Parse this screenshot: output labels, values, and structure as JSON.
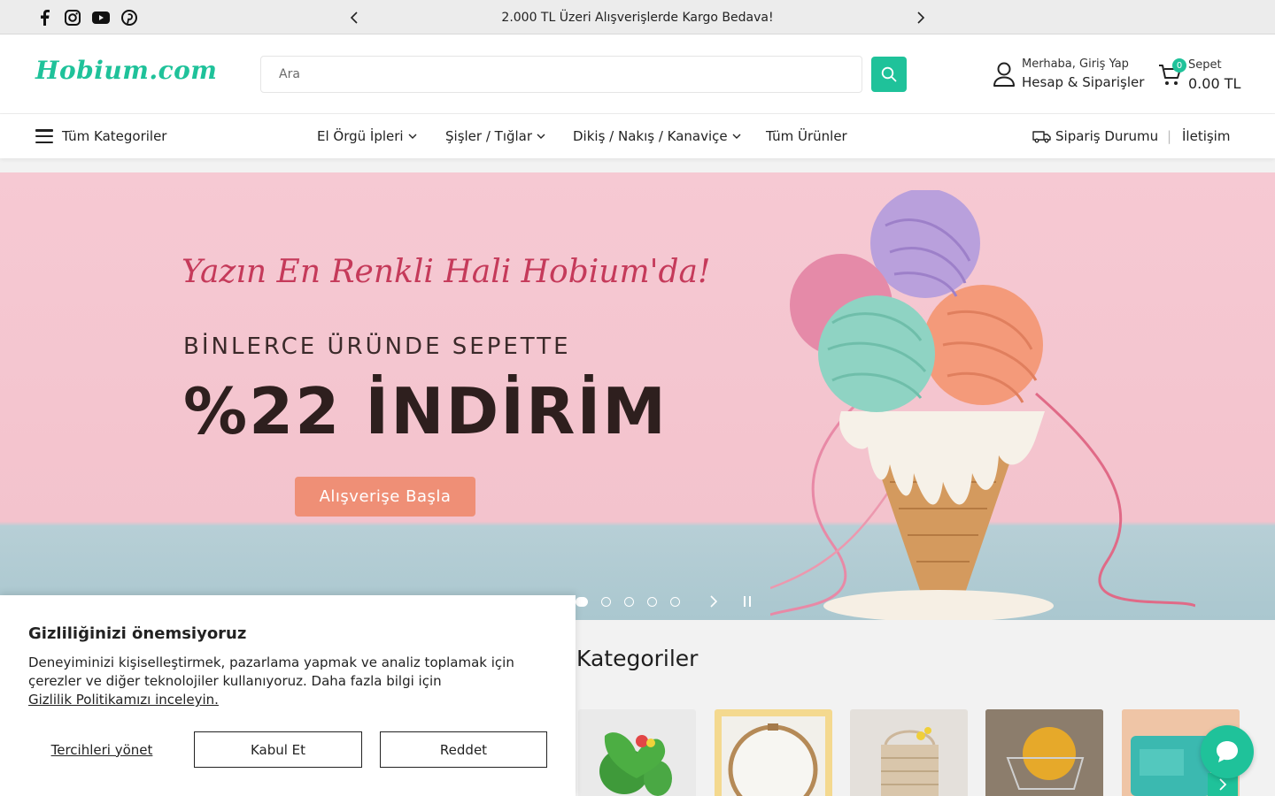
{
  "topbar": {
    "social": [
      "facebook-icon",
      "instagram-icon",
      "youtube-icon",
      "pinterest-icon"
    ],
    "promo_text": "2.000 TL Üzeri Alışverişlerde Kargo Bedava!"
  },
  "header": {
    "logo": "Hobium.com",
    "search_placeholder": "Ara",
    "account_greeting": "Merhaba, Giriş Yap",
    "account_label": "Hesap & Siparişler",
    "cart_label": "Sepet",
    "cart_total": "0.00 TL",
    "cart_count": "0"
  },
  "nav": {
    "all_categories": "Tüm Kategoriler",
    "items": [
      {
        "label": "El Örgü İpleri",
        "dropdown": true
      },
      {
        "label": "Şişler / Tığlar",
        "dropdown": true
      },
      {
        "label": "Dikiş / Nakış / Kanaviçe",
        "dropdown": true
      },
      {
        "label": "Tüm Ürünler",
        "dropdown": false
      }
    ],
    "order_status": "Sipariş Durumu",
    "separator": "|",
    "contact": "İletişim"
  },
  "hero": {
    "tagline": "Yazın En Renkli Hali Hobium'da!",
    "line1": "BİNLERCE ÜRÜNDE SEPETTE",
    "line2": "%22 İNDİRİM",
    "button": "Alışverişe Başla",
    "slide_count": 5,
    "active_slide": 1
  },
  "categories": {
    "title": "Kategoriler"
  },
  "cookie": {
    "title": "Gizliliğinizi önemsiyoruz",
    "text": "Deneyiminizi kişiselleştirmek, pazarlama yapmak ve analiz toplamak için çerezler ve diğer teknolojiler kullanıyoruz. Daha fazla bilgi için",
    "link": "Gizlilik Politikamızı inceleyin.",
    "manage": "Tercihleri yönet",
    "accept": "Kabul Et",
    "reject": "Reddet"
  },
  "colors": {
    "brand": "#1fc29a",
    "hero_bg": "#f6c9d3",
    "hero_button": "#ef8f76"
  }
}
